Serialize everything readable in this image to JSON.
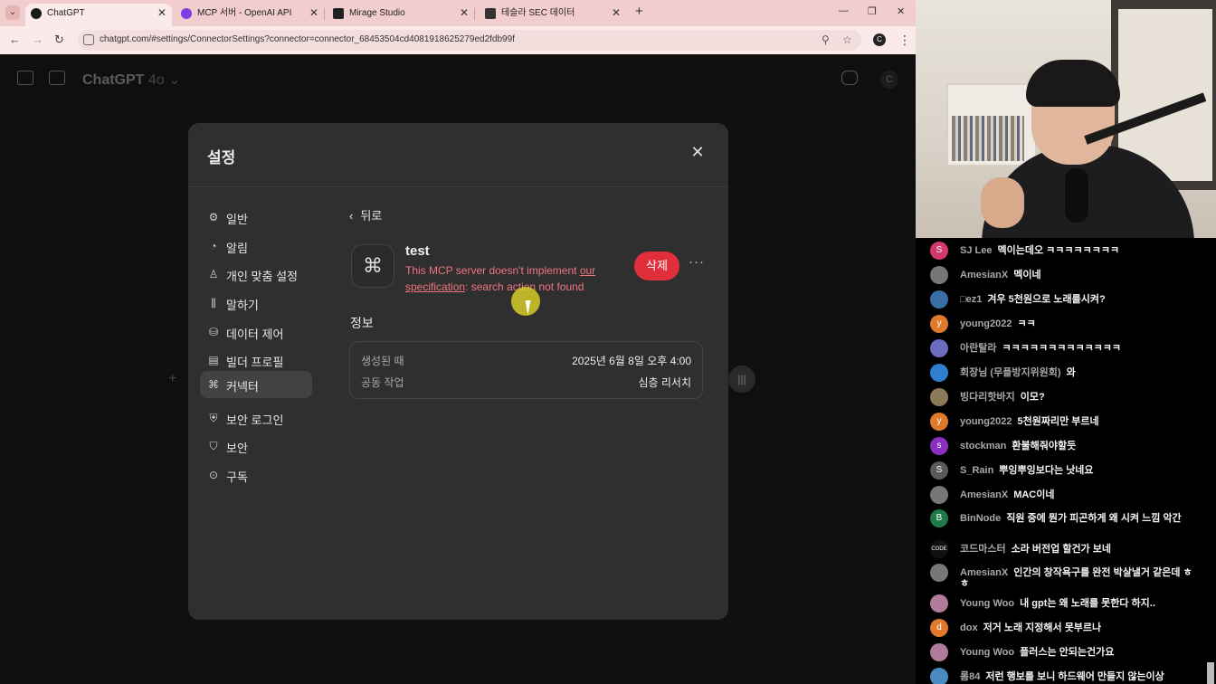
{
  "browser": {
    "tabs": [
      {
        "title": "ChatGPT",
        "favicon_color": "#1a1a1a",
        "active": true
      },
      {
        "title": "MCP 서버 - OpenAI API",
        "favicon_color": "#7b3fe4",
        "active": false
      },
      {
        "title": "Mirage Studio",
        "favicon_color": "#222222",
        "active": false
      },
      {
        "title": "테슬라 SEC 데이터",
        "favicon_color": "#333333",
        "active": false
      }
    ],
    "url": "chatgpt.com/#settings/ConnectorSettings?connector=connector_68453504cd4081918625279ed2fdb99f",
    "profile_initial": "C"
  },
  "app": {
    "model_name": "ChatGPT",
    "model_version": "4o",
    "user_initial": "C"
  },
  "settings": {
    "title": "설정",
    "sidebar": [
      {
        "label": "일반",
        "icon": "gear-icon",
        "glyph": "⚙"
      },
      {
        "label": "알림",
        "icon": "bell-icon",
        "glyph": "◔"
      },
      {
        "label": "개인 맞춤 설정",
        "icon": "person-icon",
        "glyph": "♙"
      },
      {
        "label": "말하기",
        "icon": "waveform-icon",
        "glyph": "⫼"
      },
      {
        "label": "데이터 제어",
        "icon": "database-icon",
        "glyph": "⛁"
      },
      {
        "label": "빌더 프로필",
        "icon": "id-card-icon",
        "glyph": "▤"
      },
      {
        "label": "커넥터",
        "icon": "connector-icon",
        "glyph": "⌘",
        "active": true
      },
      {
        "label": "보안 로그인",
        "icon": "secure-login-icon",
        "glyph": "⛨"
      },
      {
        "label": "보안",
        "icon": "shield-icon",
        "glyph": "⛉"
      },
      {
        "label": "구독",
        "icon": "subscription-icon",
        "glyph": "⊙"
      }
    ],
    "back_label": "뒤로",
    "connector": {
      "name": "test",
      "error_prefix": "This MCP server doesn't implement ",
      "error_link": "our specification",
      "error_suffix": ": search action not found",
      "delete_label": "삭제",
      "more_label": "···"
    },
    "info": {
      "title": "정보",
      "rows": [
        {
          "key": "생성된 때",
          "value": "2025년 6월 8일 오후 4:00"
        },
        {
          "key": "공동 작업",
          "value": "심층 리서치"
        }
      ]
    }
  },
  "live_chat": {
    "messages": [
      {
        "user": "SJ Lee",
        "text": "멕이는데오 ㅋㅋㅋㅋㅋㅋㅋㅋ",
        "avatar": "S",
        "color": "#d23a6a"
      },
      {
        "user": "AmesianX",
        "text": "멕이네",
        "avatar": "",
        "color": "#777777"
      },
      {
        "user": "□ez1",
        "text": "겨우 5천원으로 노래를시켜?",
        "avatar": "",
        "color": "#3b6ea5"
      },
      {
        "user": "young2022",
        "text": "ㅋㅋ",
        "avatar": "y",
        "color": "#e0792b"
      },
      {
        "user": "아란탈라",
        "text": "ㅋㅋㅋㅋㅋㅋㅋㅋㅋㅋㅋㅋㅋ",
        "avatar": "",
        "color": "#6b6bbf"
      },
      {
        "user": "회장님 (무플방지위원회)",
        "text": "와",
        "avatar": "",
        "color": "#2f7fd0"
      },
      {
        "user": "빙다리핫바지",
        "text": "이모?",
        "avatar": "",
        "color": "#8a7a5a"
      },
      {
        "user": "young2022",
        "text": "5천원짜리만 부르네",
        "avatar": "y",
        "color": "#e0792b"
      },
      {
        "user": "stockman",
        "text": "환불해줘야할듯",
        "avatar": "s",
        "color": "#8a2fbf"
      },
      {
        "user": "S_Rain",
        "text": "뿌잉뿌잉보다는 낫네요",
        "avatar": "S",
        "color": "#5a5a5a"
      },
      {
        "user": "AmesianX",
        "text": "MAC이네",
        "avatar": "",
        "color": "#777777"
      },
      {
        "user": "BinNode",
        "text": "직원 중에 뭔가 피곤하게 왜 시켜 느낌 악간",
        "avatar": "B",
        "color": "#1f7a4a"
      },
      {
        "user": "코드마스터",
        "text": "소라 버전업 할건가 보네",
        "avatar": "CODE",
        "color": "#111111"
      },
      {
        "user": "AmesianX",
        "text": "인간의 창작욕구를 완전 박살낼거 같은데 ㅎㅎ",
        "avatar": "",
        "color": "#777777"
      },
      {
        "user": "Young Woo",
        "text": "내 gpt는 왜 노래를 못한다 하지..",
        "avatar": "",
        "color": "#b07a9a"
      },
      {
        "user": "dox",
        "text": "저거 노래 지정해서 못부르나",
        "avatar": "d",
        "color": "#e0792b"
      },
      {
        "user": "Young Woo",
        "text": "플러스는 안되는건가요",
        "avatar": "",
        "color": "#b07a9a"
      },
      {
        "user": "롬84",
        "text": "저런 행보를 보니 하드웨어 만들지 않는이상",
        "avatar": "",
        "color": "#4a8ac0"
      }
    ]
  }
}
